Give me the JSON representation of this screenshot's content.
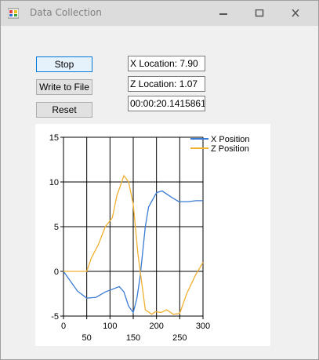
{
  "window": {
    "title": "Data Collection",
    "icon": "app-icon"
  },
  "buttons": {
    "stop": "Stop",
    "write": "Write to File",
    "reset": "Reset"
  },
  "readouts": {
    "x_location": "X Location: 7.90",
    "z_location": "Z Location: 1.07",
    "elapsed": "00:00:20.1415861"
  },
  "chart_data": {
    "type": "line",
    "xlim": [
      0,
      300
    ],
    "ylim": [
      -5,
      15
    ],
    "xticks_top_row": [
      "0",
      "100",
      "200",
      "300"
    ],
    "xticks_bottom_row": [
      "50",
      "150",
      "250"
    ],
    "yticks": [
      "15",
      "10",
      "5",
      "0",
      "-5"
    ],
    "grid": true,
    "legend": "top-right",
    "series": [
      {
        "name": "X Position",
        "color": "#3a7bd5",
        "points": [
          [
            0,
            0
          ],
          [
            30,
            -2.2
          ],
          [
            50,
            -3
          ],
          [
            70,
            -2.9
          ],
          [
            90,
            -2.3
          ],
          [
            105,
            -2
          ],
          [
            120,
            -1.7
          ],
          [
            130,
            -2.3
          ],
          [
            140,
            -3.9
          ],
          [
            150,
            -4.6
          ],
          [
            158,
            -3
          ],
          [
            165,
            -0.5
          ],
          [
            176,
            5
          ],
          [
            183,
            7.2
          ],
          [
            200,
            8.8
          ],
          [
            212,
            9
          ],
          [
            232,
            8.3
          ],
          [
            248,
            7.8
          ],
          [
            268,
            7.8
          ],
          [
            285,
            7.9
          ],
          [
            300,
            7.9
          ]
        ]
      },
      {
        "name": "Z Position",
        "color": "#f0b030",
        "points": [
          [
            0,
            0
          ],
          [
            30,
            0
          ],
          [
            50,
            0
          ],
          [
            60,
            1.5
          ],
          [
            75,
            3
          ],
          [
            90,
            5
          ],
          [
            105,
            6
          ],
          [
            115,
            8.5
          ],
          [
            130,
            10.7
          ],
          [
            140,
            10
          ],
          [
            150,
            7.5
          ],
          [
            160,
            2
          ],
          [
            176,
            -4.3
          ],
          [
            190,
            -4.8
          ],
          [
            198,
            -4.5
          ],
          [
            210,
            -4.6
          ],
          [
            222,
            -4.3
          ],
          [
            236,
            -4.8
          ],
          [
            250,
            -4.7
          ],
          [
            265,
            -2.5
          ],
          [
            283,
            -0.5
          ],
          [
            300,
            1
          ]
        ]
      }
    ]
  }
}
